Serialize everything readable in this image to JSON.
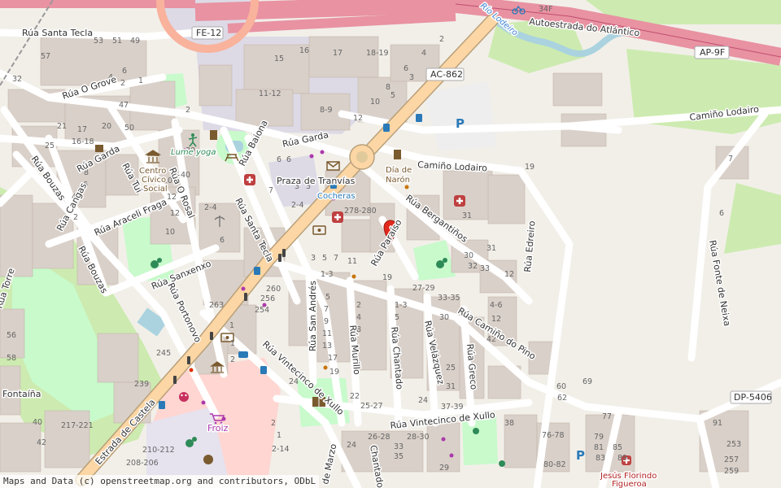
{
  "map": {
    "streets": {
      "santa_tecla_top": "Rúa Santa Tecla",
      "o_grove": "Rúa O Grove",
      "garda_left": "Rúa Garda",
      "garda_mid": "Rúa Garda",
      "bouzas_top": "Rúa Bouzas",
      "bouzas_low": "Rúa Bouzas",
      "cangas": "Rúa Cangas",
      "tui": "Rúa Tui",
      "o_rosal": "Rúa O Rosal",
      "araceli": "Rúa Araceli Fraga",
      "sanxenxo": "Rúa Sanxenxo",
      "portonovo": "Rúa Portonovo",
      "baiona": "Rúa Baiona",
      "santa_tecla_mid": "Rúa Santa Tecla",
      "torre": "Rúa Torre",
      "castela": "Estrada de Castela",
      "vintecinco_left": "Rúa Vintecinco de Xullo",
      "vintecinco_right": "Rúa Vintecinco de Xullo",
      "san_andres": "Rúa San Andrés",
      "murillo": "Rúa Murillo",
      "chantado": "Rúa Chantado",
      "chantado_low": "Chantado",
      "velazquez": "Rúa Velázquez",
      "greco": "Rúa Greco",
      "camino_pino": "Rúa Camiño do Pino",
      "bergantinos": "Rúa Bergantiños",
      "paraiso": "Rúa Paraíso",
      "lodairo_mid": "Camiño Lodairo",
      "lodairo_right": "Camiño Lodairo",
      "edreiro": "Rúa Edreiro",
      "fonte_neixa": "Rúa Fonte de Neixa",
      "marzo": "de Marzo",
      "autoestrada": "Autoestrada do Atlántico",
      "rio": "Río Lodeiro"
    },
    "shields": {
      "fe12": "FE-12",
      "ac862": "AC-862",
      "ap9f": "AP-9F",
      "dp5406": "DP-5406",
      "exit34f": "34F"
    },
    "places": {
      "praza": "Praza de Tranvías",
      "cocheras": "Cocheras",
      "lume": "Lume yoga",
      "centro": [
        "Centro",
        "Cívico",
        "Social"
      ],
      "dia": [
        "Día de",
        "Narón"
      ],
      "froiz": "Froiz",
      "fontaina": "Fontaíña",
      "jesus": [
        "Jesús Florindo",
        "Figueroa"
      ]
    },
    "housenumbers": [
      "53",
      "51",
      "49",
      "57",
      "32",
      "6",
      "4",
      "2",
      "1",
      "47",
      "50",
      "21",
      "17",
      "16-18",
      "20",
      "25",
      "15",
      "16",
      "17",
      "18-19",
      "3",
      "5",
      "11-12",
      "8-9",
      "2",
      "4",
      "6",
      "8",
      "10",
      "12",
      "30",
      "40",
      "2-4",
      "6",
      "8",
      "10",
      "12",
      "14",
      "3",
      "6",
      "6",
      "278-280",
      "260",
      "256",
      "254",
      "263",
      "245",
      "239",
      "1",
      "2",
      "3",
      "5",
      "7",
      "11",
      "19",
      "27-29",
      "33-35",
      "30",
      "1-3",
      "5",
      "7",
      "9",
      "11",
      "13",
      "17",
      "19",
      "22",
      "25-27",
      "24",
      "37-39",
      "4-6",
      "12",
      "42",
      "60",
      "62",
      "69",
      "77",
      "76-78",
      "79",
      "81",
      "83",
      "80-82",
      "85",
      "89",
      "91",
      "253",
      "257",
      "259",
      "217-221",
      "210-212",
      "208-206",
      "2-14",
      "1",
      "24",
      "26-28",
      "28-30",
      "33",
      "35",
      "29",
      "38",
      "31",
      "32",
      "19",
      "56",
      "58",
      "40",
      "42"
    ],
    "attribution": "Maps and Data (c) openstreetmap.org and contributors, ODbL"
  },
  "colors": {
    "background": "#f2efe9",
    "building": "#d9d0c9",
    "motorway": "#e892a2",
    "primary": "#fcd6a4",
    "park": "#c8facc",
    "grass": "#cdebb0",
    "water": "#aad3df",
    "retail": "#ffd6d1",
    "marker": "#e0291e"
  },
  "icons": [
    "parking-icon",
    "bus-stop-icon",
    "pharmacy-icon",
    "hospital-icon",
    "post-office-icon",
    "atm-icon",
    "library-icon",
    "theatre-icon",
    "playground-icon",
    "yoga-icon",
    "supermarket-icon",
    "museum-icon",
    "bicycle-icon",
    "fuel-icon",
    "location-marker-icon"
  ]
}
